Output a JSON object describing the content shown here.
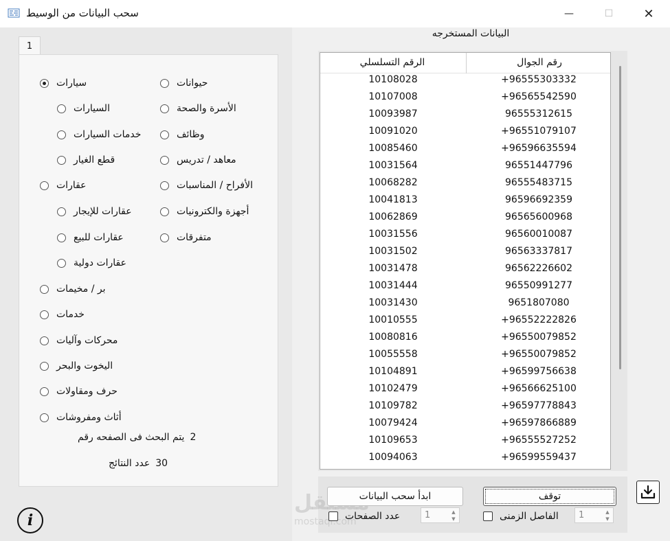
{
  "window": {
    "title": "سحب البيانات من الوسيط",
    "controls": {
      "minimize": "—",
      "maximize": "☐",
      "close": "✕"
    }
  },
  "tab": {
    "label": "1"
  },
  "categories": {
    "left_column": [
      {
        "label": "سيارات",
        "selected": true
      },
      {
        "label": "السيارات",
        "selected": false
      },
      {
        "label": "خدمات السيارات",
        "selected": false
      },
      {
        "label": "قطع الغيار",
        "selected": false
      },
      {
        "label": "عقارات",
        "selected": false
      },
      {
        "label": "عقارات للإيجار",
        "selected": false
      },
      {
        "label": "عقارات للبيع",
        "selected": false
      },
      {
        "label": "عقارات دولية",
        "selected": false
      },
      {
        "label": "بر / مخيمات",
        "selected": false
      },
      {
        "label": "خدمات",
        "selected": false
      },
      {
        "label": "محركات وآليات",
        "selected": false
      },
      {
        "label": "اليخوت والبحر",
        "selected": false
      },
      {
        "label": "حرف ومقاولات",
        "selected": false
      },
      {
        "label": "أثاث ومفروشات",
        "selected": false
      }
    ],
    "right_column": [
      {
        "label": "حيوانات",
        "selected": false
      },
      {
        "label": "الأسرة والصحة",
        "selected": false
      },
      {
        "label": "وظائف",
        "selected": false
      },
      {
        "label": "معاهد / تدريس",
        "selected": false
      },
      {
        "label": "الأفراح / المناسبات",
        "selected": false
      },
      {
        "label": "أجهزة والكترونيات",
        "selected": false
      },
      {
        "label": "متفرقات",
        "selected": false
      }
    ]
  },
  "status": {
    "search_page_label": "يتم البحث فى الصفحه رقم",
    "search_page_value": "2",
    "results_label": "عدد النتائج",
    "results_value": "30"
  },
  "extracted": {
    "title": "البيانات المستخرجه",
    "columns": {
      "serial": "الرقم التسلسلي",
      "mobile": "رقم الجوال"
    },
    "rows": [
      {
        "serial": "10108028",
        "mobile": "+96555303332"
      },
      {
        "serial": "10107008",
        "mobile": "+96565542590"
      },
      {
        "serial": "10093987",
        "mobile": "96555312615"
      },
      {
        "serial": "10091020",
        "mobile": "+96551079107"
      },
      {
        "serial": "10085460",
        "mobile": "+96596635594"
      },
      {
        "serial": "10031564",
        "mobile": "96551447796"
      },
      {
        "serial": "10068282",
        "mobile": "96555483715"
      },
      {
        "serial": "10041813",
        "mobile": "96596692359"
      },
      {
        "serial": "10062869",
        "mobile": "96565600968"
      },
      {
        "serial": "10031556",
        "mobile": "96560010087"
      },
      {
        "serial": "10031502",
        "mobile": "96563337817"
      },
      {
        "serial": "10031478",
        "mobile": "96562226602"
      },
      {
        "serial": "10031444",
        "mobile": "96550991277"
      },
      {
        "serial": "10031430",
        "mobile": "9651807080"
      },
      {
        "serial": "10010555",
        "mobile": "+96552222826"
      },
      {
        "serial": "10080816",
        "mobile": "+96550079852"
      },
      {
        "serial": "10055558",
        "mobile": "+96550079852"
      },
      {
        "serial": "10104891",
        "mobile": "+96599756638"
      },
      {
        "serial": "10102479",
        "mobile": "+96566625100"
      },
      {
        "serial": "10109782",
        "mobile": "+96597778843"
      },
      {
        "serial": "10079424",
        "mobile": "+96597866889"
      },
      {
        "serial": "10109653",
        "mobile": "+96555527252"
      },
      {
        "serial": "10094063",
        "mobile": "+96599559437"
      }
    ]
  },
  "controls": {
    "stop_label": "توقف",
    "start_label": "ابدأ سحب البيانات",
    "interval_label": "الفاصل الزمنى",
    "interval_value": "1",
    "pages_label": "عدد الصفحات",
    "pages_value": "1"
  },
  "watermark": {
    "main": "مستقل",
    "sub": "mostaql.com"
  }
}
